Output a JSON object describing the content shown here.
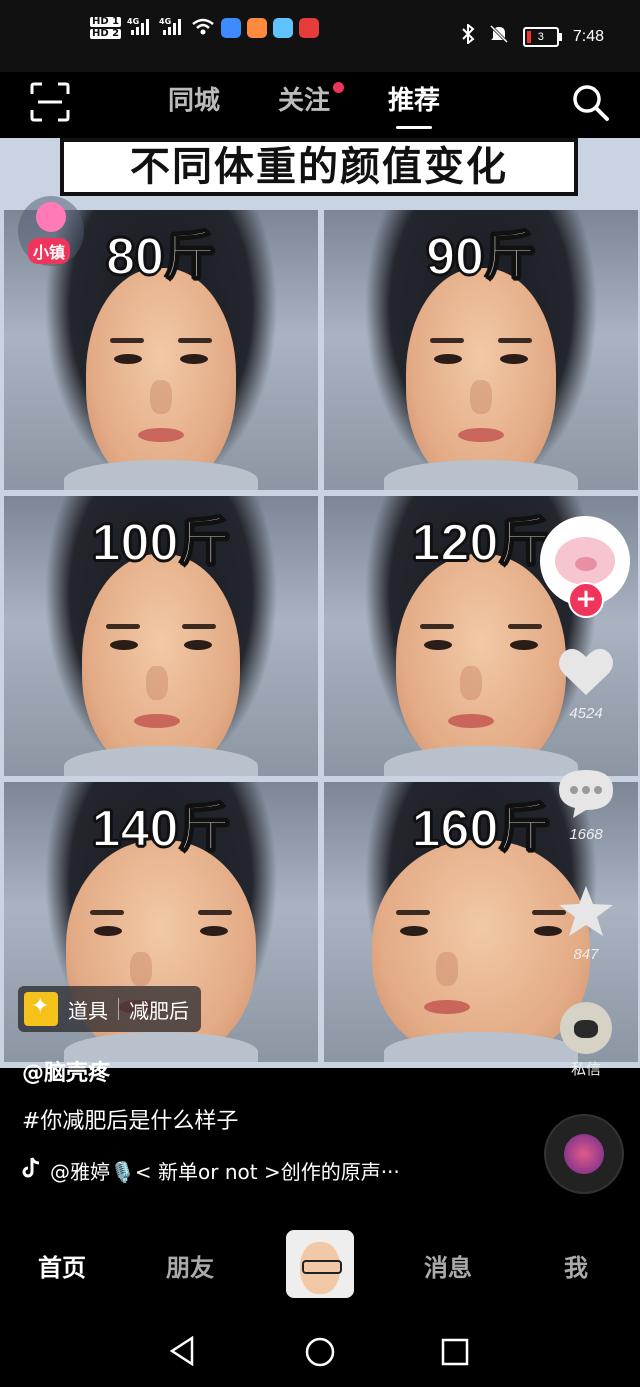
{
  "status_bar": {
    "hd1": "HD 1",
    "hd2": "HD 2",
    "net1": "4G",
    "net2": "4G",
    "battery": "3",
    "time": "7:48"
  },
  "top_nav": {
    "tabs": [
      {
        "label": "同城"
      },
      {
        "label": "关注",
        "has_dot": true
      },
      {
        "label": "推荐",
        "active": true
      }
    ]
  },
  "video": {
    "banner": "不同体重的颜值变化",
    "town_badge": "小镇",
    "weights": [
      "80斤",
      "90斤",
      "100斤",
      "120斤",
      "140斤",
      "160斤"
    ],
    "prop": {
      "label": "道具",
      "name": "减肥后"
    },
    "author": "@脑壳疼",
    "hashtag": "#你减肥后是什么样子",
    "music": "@雅婷🎙️< 新单or not >创作的原声···"
  },
  "side_actions": {
    "likes": "4524",
    "comments": "1668",
    "favorites": "847",
    "dm": "私信"
  },
  "bottom_nav": {
    "home": "首页",
    "friends": "朋友",
    "messages": "消息",
    "me": "我"
  },
  "colors": {
    "accent": "#f0355c",
    "background": "#000000"
  }
}
